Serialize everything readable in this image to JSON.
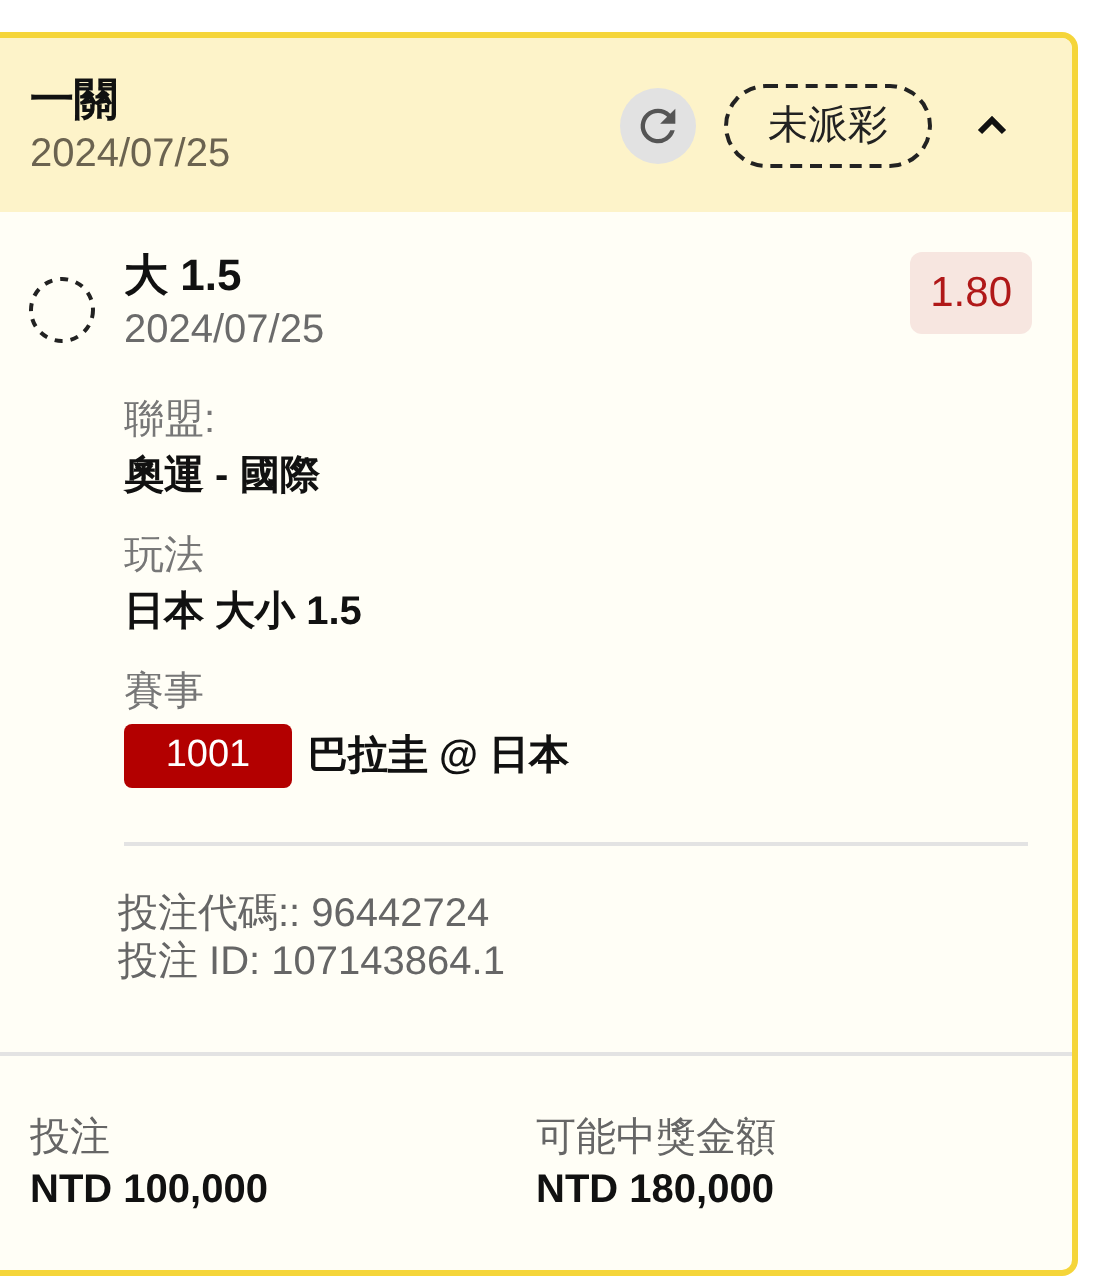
{
  "header": {
    "title": "一關",
    "date": "2024/07/25",
    "status": "未派彩",
    "expanded": true
  },
  "selection": {
    "name": "大 1.5",
    "date": "2024/07/25",
    "odds": "1.80"
  },
  "details": [
    {
      "kind": "text",
      "label": "聯盟:",
      "value": "奧運 - 國際"
    },
    {
      "kind": "text",
      "label": "玩法",
      "value": "日本 大小 1.5"
    },
    {
      "kind": "event",
      "label": "賽事",
      "code": "1001",
      "value": "巴拉圭 @ 日本"
    }
  ],
  "bet_code": "投注代碼:: 96442724",
  "bet_id": "投注 ID: 107143864.1",
  "stake": {
    "label": "投注",
    "value": "NTD 100,000"
  },
  "payout": {
    "label": "可能中獎金額",
    "value": "NTD 180,000"
  }
}
